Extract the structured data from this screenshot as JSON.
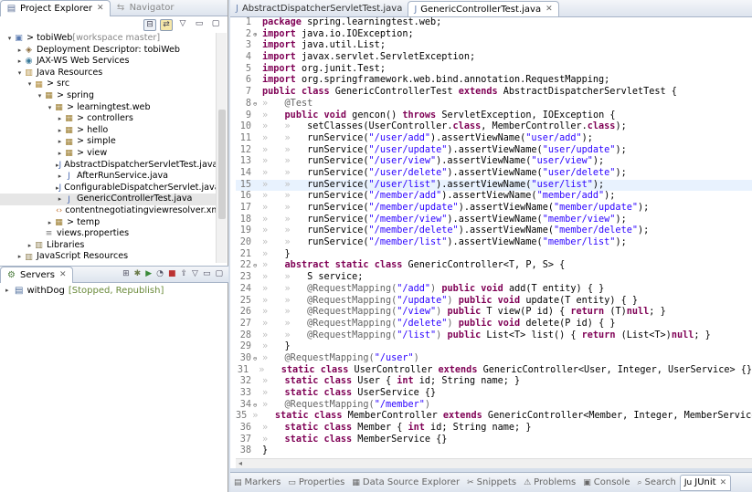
{
  "left_panel": {
    "tabs": [
      {
        "label": "Project Explorer",
        "icon": "project-explorer-icon"
      },
      {
        "label": "Navigator",
        "icon": "navigator-icon"
      }
    ],
    "tree": [
      {
        "indent": 0,
        "twisty": "▾",
        "icon": "project",
        "label": "> tobiWeb",
        "decoration": " [workspace master]"
      },
      {
        "indent": 1,
        "twisty": "▸",
        "icon": "descriptor",
        "label": "Deployment Descriptor: tobiWeb",
        "decoration": ""
      },
      {
        "indent": 1,
        "twisty": "▸",
        "icon": "webservices",
        "label": "JAX-WS Web Services",
        "decoration": ""
      },
      {
        "indent": 1,
        "twisty": "▾",
        "icon": "javares",
        "label": "Java Resources",
        "decoration": ""
      },
      {
        "indent": 2,
        "twisty": "▾",
        "icon": "srcfolder",
        "label": "> src",
        "decoration": ""
      },
      {
        "indent": 3,
        "twisty": "▾",
        "icon": "package",
        "label": "> spring",
        "decoration": ""
      },
      {
        "indent": 4,
        "twisty": "▾",
        "icon": "package",
        "label": "> learningtest.web",
        "decoration": ""
      },
      {
        "indent": 5,
        "twisty": "▸",
        "icon": "package",
        "label": "> controllers",
        "decoration": ""
      },
      {
        "indent": 5,
        "twisty": "▸",
        "icon": "package",
        "label": "> hello",
        "decoration": ""
      },
      {
        "indent": 5,
        "twisty": "▸",
        "icon": "package",
        "label": "> simple",
        "decoration": ""
      },
      {
        "indent": 5,
        "twisty": "▸",
        "icon": "package",
        "label": "> view",
        "decoration": ""
      },
      {
        "indent": 5,
        "twisty": "▸",
        "icon": "javafile",
        "label": "AbstractDispatcherServletTest.java",
        "decoration": ""
      },
      {
        "indent": 5,
        "twisty": "▸",
        "icon": "javafile",
        "label": "AfterRunService.java",
        "decoration": ""
      },
      {
        "indent": 5,
        "twisty": "▸",
        "icon": "javafile",
        "label": "ConfigurableDispatcherServlet.java",
        "decoration": ""
      },
      {
        "indent": 5,
        "twisty": "▸",
        "icon": "javafile",
        "label": "GenericControllerTest.java",
        "decoration": "",
        "selected": true
      },
      {
        "indent": 5,
        "twisty": "",
        "icon": "xmlfile",
        "label": "contentnegotiatingviewresolver.xml",
        "decoration": ""
      },
      {
        "indent": 4,
        "twisty": "▸",
        "icon": "package",
        "label": "> temp",
        "decoration": ""
      },
      {
        "indent": 3,
        "twisty": "",
        "icon": "propfile",
        "label": "views.properties",
        "decoration": ""
      },
      {
        "indent": 2,
        "twisty": "▸",
        "icon": "library",
        "label": "Libraries",
        "decoration": ""
      },
      {
        "indent": 1,
        "twisty": "▸",
        "icon": "jsres",
        "label": "JavaScript Resources",
        "decoration": ""
      }
    ],
    "servers_tab": {
      "label": "Servers",
      "icon": "servers-icon"
    },
    "server": {
      "name": "withDog",
      "status": "[Stopped, Republish]"
    }
  },
  "editor": {
    "tabs": [
      {
        "label": "AbstractDispatcherServletTest.java",
        "active": false
      },
      {
        "label": "GenericControllerTest.java",
        "active": true
      }
    ],
    "current_line": 15,
    "lines": [
      {
        "n": "1",
        "fold": "",
        "html": "<span class='kw'>package</span> spring.learningtest.web;"
      },
      {
        "n": "2",
        "fold": "⊕",
        "html": "<span class='kw'>import</span> java.io.IOException;"
      },
      {
        "n": "3",
        "fold": "",
        "html": "<span class='kw'>import</span> java.util.List;"
      },
      {
        "n": "4",
        "fold": "",
        "html": "<span class='kw'>import</span> javax.servlet.ServletException;"
      },
      {
        "n": "5",
        "fold": "",
        "html": "<span class='kw'>import</span> org.junit.Test;"
      },
      {
        "n": "6",
        "fold": "",
        "html": "<span class='kw'>import</span> org.springframework.web.bind.annotation.RequestMapping;"
      },
      {
        "n": "7",
        "fold": "",
        "html": "<span class='kw'>public</span> <span class='kw'>class</span> GenericControllerTest <span class='kw'>extends</span> AbstractDispatcherServletTest {"
      },
      {
        "n": "8",
        "fold": "⊖",
        "html": "<span class='ws'>»   </span><span class='ann'>@Test</span>"
      },
      {
        "n": "9",
        "fold": "",
        "html": "<span class='ws'>»   </span><span class='kw'>public</span> <span class='kw'>void</span> gencon() <span class='kw'>throws</span> ServletException, IOException {"
      },
      {
        "n": "10",
        "fold": "",
        "html": "<span class='ws'>»   »   </span>setClasses(UserController.<span class='kw'>class</span>, MemberController.<span class='kw'>class</span>);"
      },
      {
        "n": "11",
        "fold": "",
        "html": "<span class='ws'>»   »   </span>runService(<span class='str'>\"/user/add\"</span>).assertViewName(<span class='str'>\"user/add\"</span>);"
      },
      {
        "n": "12",
        "fold": "",
        "html": "<span class='ws'>»   »   </span>runService(<span class='str'>\"/user/update\"</span>).assertViewName(<span class='str'>\"user/update\"</span>);"
      },
      {
        "n": "13",
        "fold": "",
        "html": "<span class='ws'>»   »   </span>runService(<span class='str'>\"/user/view\"</span>).assertViewName(<span class='str'>\"user/view\"</span>);"
      },
      {
        "n": "14",
        "fold": "",
        "html": "<span class='ws'>»   »   </span>runService(<span class='str'>\"/user/delete\"</span>).assertViewName(<span class='str'>\"user/delete\"</span>);"
      },
      {
        "n": "15",
        "fold": "",
        "html": "<span class='ws'>»   »   </span>runService(<span class='str'>\"/user/list\"</span>).assertViewName(<span class='str'>\"user/list\"</span>);"
      },
      {
        "n": "16",
        "fold": "",
        "html": "<span class='ws'>»   »   </span>runService(<span class='str'>\"/member/add\"</span>).assertViewName(<span class='str'>\"member/add\"</span>);"
      },
      {
        "n": "17",
        "fold": "",
        "html": "<span class='ws'>»   »   </span>runService(<span class='str'>\"/member/update\"</span>).assertViewName(<span class='str'>\"member/update\"</span>);"
      },
      {
        "n": "18",
        "fold": "",
        "html": "<span class='ws'>»   »   </span>runService(<span class='str'>\"/member/view\"</span>).assertViewName(<span class='str'>\"member/view\"</span>);"
      },
      {
        "n": "19",
        "fold": "",
        "html": "<span class='ws'>»   »   </span>runService(<span class='str'>\"/member/delete\"</span>).assertViewName(<span class='str'>\"member/delete\"</span>);"
      },
      {
        "n": "20",
        "fold": "",
        "html": "<span class='ws'>»   »   </span>runService(<span class='str'>\"/member/list\"</span>).assertViewName(<span class='str'>\"member/list\"</span>);"
      },
      {
        "n": "21",
        "fold": "",
        "html": "<span class='ws'>»   </span>}"
      },
      {
        "n": "22",
        "fold": "⊖",
        "html": "<span class='ws'>»   </span><span class='kw'>abstract</span> <span class='kw'>static</span> <span class='kw'>class</span> GenericController&lt;T, P, S&gt; {"
      },
      {
        "n": "23",
        "fold": "",
        "html": "<span class='ws'>»   »   </span>S service;"
      },
      {
        "n": "24",
        "fold": "",
        "html": "<span class='ws'>»   »   </span><span class='ann'>@RequestMapping(</span><span class='str'>\"/add\"</span><span class='ann'>)</span> <span class='kw'>public</span> <span class='kw'>void</span> add(T entity) { }"
      },
      {
        "n": "25",
        "fold": "",
        "html": "<span class='ws'>»   »   </span><span class='ann'>@RequestMapping(</span><span class='str'>\"/update\"</span><span class='ann'>)</span> <span class='kw'>public</span> <span class='kw'>void</span> update(T entity) { }"
      },
      {
        "n": "26",
        "fold": "",
        "html": "<span class='ws'>»   »   </span><span class='ann'>@RequestMapping(</span><span class='str'>\"/view\"</span><span class='ann'>)</span> <span class='kw'>public</span> T view(P id) { <span class='kw'>return</span> (T)<span class='kw'>null</span>; }"
      },
      {
        "n": "27",
        "fold": "",
        "html": "<span class='ws'>»   »   </span><span class='ann'>@RequestMapping(</span><span class='str'>\"/delete\"</span><span class='ann'>)</span> <span class='kw'>public</span> <span class='kw'>void</span> delete(P id) { }"
      },
      {
        "n": "28",
        "fold": "",
        "html": "<span class='ws'>»   »   </span><span class='ann'>@RequestMapping(</span><span class='str'>\"/list\"</span><span class='ann'>)</span> <span class='kw'>public</span> List&lt;T&gt; list() { <span class='kw'>return</span> (List&lt;T&gt;)<span class='kw'>null</span>; }"
      },
      {
        "n": "29",
        "fold": "",
        "html": "<span class='ws'>»   </span>}"
      },
      {
        "n": "30",
        "fold": "⊖",
        "html": "<span class='ws'>»   </span><span class='ann'>@RequestMapping(</span><span class='str'>\"/user\"</span><span class='ann'>)</span>"
      },
      {
        "n": "31",
        "fold": "",
        "html": "<span class='ws'>»   </span><span class='kw'>static</span> <span class='kw'>class</span> UserController <span class='kw'>extends</span> GenericController&lt;User, Integer, UserService&gt; {}"
      },
      {
        "n": "32",
        "fold": "",
        "html": "<span class='ws'>»   </span><span class='kw'>static</span> <span class='kw'>class</span> User { <span class='kw'>int</span> id; String name; }"
      },
      {
        "n": "33",
        "fold": "",
        "html": "<span class='ws'>»   </span><span class='kw'>static</span> <span class='kw'>class</span> UserService {}"
      },
      {
        "n": "34",
        "fold": "⊖",
        "html": "<span class='ws'>»   </span><span class='ann'>@RequestMapping(</span><span class='str'>\"/member\"</span><span class='ann'>)</span>"
      },
      {
        "n": "35",
        "fold": "",
        "html": "<span class='ws'>»   </span><span class='kw'>static</span> <span class='kw'>class</span> MemberController <span class='kw'>extends</span> GenericController&lt;Member, Integer, MemberService&gt; {}"
      },
      {
        "n": "36",
        "fold": "",
        "html": "<span class='ws'>»   </span><span class='kw'>static</span> <span class='kw'>class</span> Member { <span class='kw'>int</span> id; String name; }"
      },
      {
        "n": "37",
        "fold": "",
        "html": "<span class='ws'>»   </span><span class='kw'>static</span> <span class='kw'>class</span> MemberService {}"
      },
      {
        "n": "38",
        "fold": "",
        "html": "}"
      }
    ]
  },
  "bottom_tabs": [
    {
      "label": "Markers",
      "icon": "markers-icon"
    },
    {
      "label": "Properties",
      "icon": "properties-icon"
    },
    {
      "label": "Data Source Explorer",
      "icon": "datasource-icon"
    },
    {
      "label": "Snippets",
      "icon": "snippets-icon"
    },
    {
      "label": "Problems",
      "icon": "problems-icon"
    },
    {
      "label": "Console",
      "icon": "console-icon"
    },
    {
      "label": "Search",
      "icon": "search-icon"
    },
    {
      "label": "JUnit",
      "icon": "junit-icon",
      "active": true
    }
  ],
  "colors": {
    "keyword": "#7f0055",
    "string": "#2a00ff",
    "annotation": "#646464",
    "current_line": "#e8f2fe"
  }
}
